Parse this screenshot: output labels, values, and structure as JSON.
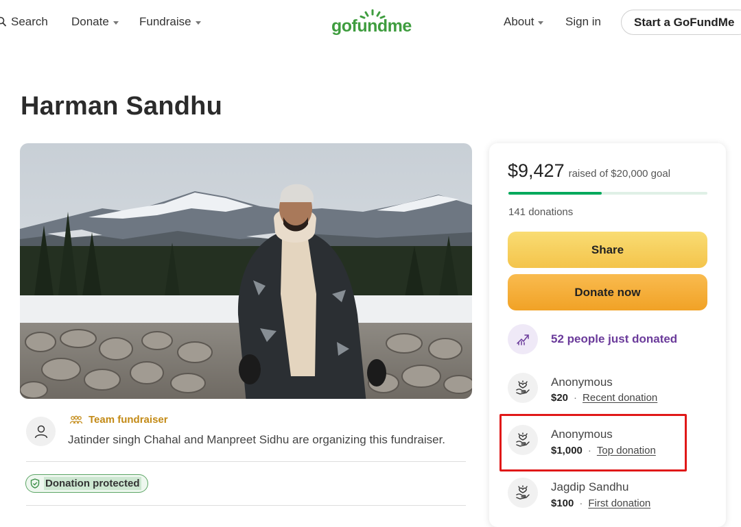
{
  "header": {
    "search_label": "Search",
    "donate_label": "Donate",
    "fundraise_label": "Fundraise",
    "logo_text": "gofundme",
    "about_label": "About",
    "signin_label": "Sign in",
    "start_label": "Start a GoFundMe"
  },
  "page_title": "Harman Sandhu",
  "organizer": {
    "team_label": "Team fundraiser",
    "text": "Jatinder singh Chahal and Manpreet Sidhu are organizing this fundraiser.",
    "protected_label": "Donation protected"
  },
  "card": {
    "raised_amount": "$9,427",
    "raised_goal_text": "raised of $20,000 goal",
    "progress_fraction": 0.47,
    "donations_count": "141 donations",
    "share_label": "Share",
    "donate_label": "Donate now",
    "trend_text": "52 people just donated",
    "donors": [
      {
        "name": "Anonymous",
        "amount": "$20",
        "tag": "Recent donation"
      },
      {
        "name": "Anonymous",
        "amount": "$1,000",
        "tag": "Top donation"
      },
      {
        "name": "Jagdip Sandhu",
        "amount": "$100",
        "tag": "First donation"
      }
    ]
  },
  "colors": {
    "brand_green": "#02a95c",
    "share_yellow": "#f4c44b",
    "donate_orange": "#f1a226",
    "trend_purple": "#6a3a9a",
    "highlight_red": "#e01818"
  }
}
